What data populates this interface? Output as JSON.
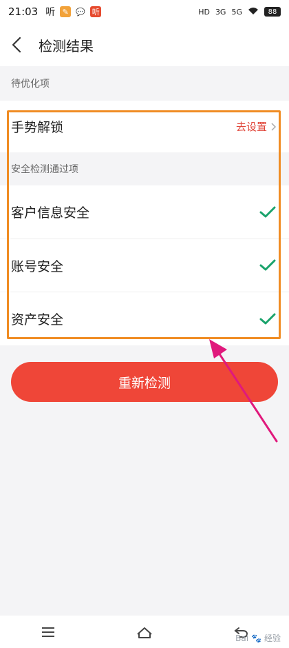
{
  "status_bar": {
    "time": "21:03",
    "notif_icons": [
      "听",
      "news",
      "💬",
      "听"
    ],
    "network": [
      "HD",
      "3G",
      "5G"
    ],
    "wifi": "wifi",
    "battery": "88"
  },
  "appbar": {
    "title": "检测结果"
  },
  "sections": {
    "pending_title": "待优化项",
    "passed_title": "安全检测通过项"
  },
  "pending_items": [
    {
      "label": "手势解锁",
      "action": "去设置"
    }
  ],
  "passed_items": [
    {
      "label": "客户信息安全"
    },
    {
      "label": "账号安全"
    },
    {
      "label": "资产安全"
    }
  ],
  "primary_button": {
    "label": "重新检测"
  },
  "colors": {
    "accent": "#ef4638",
    "check": "#1aa36c",
    "highlight": "#f08c23",
    "annotation_arrow": "#e0197c"
  },
  "watermark": {
    "text": "经验",
    "brand": "Bai"
  }
}
